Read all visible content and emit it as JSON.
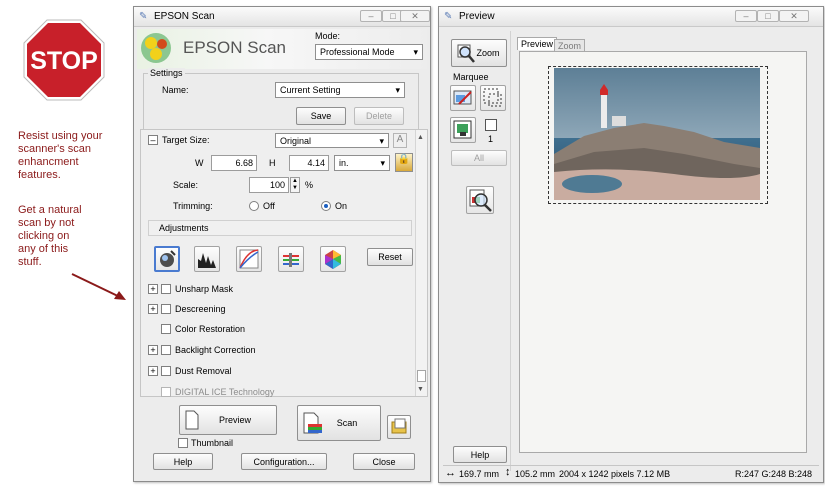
{
  "annotation": {
    "stop_text": "STOP",
    "note1": [
      "Resist using your",
      "scanner's scan",
      "enhancment",
      "features."
    ],
    "note2": [
      "Get a natural",
      "scan by not",
      "clicking on",
      "any of this",
      "stuff."
    ]
  },
  "epson": {
    "title": "EPSON Scan",
    "banner_text": "EPSON Scan",
    "mode_label": "Mode:",
    "mode_value": "Professional Mode",
    "settings_group": "Settings",
    "name_label": "Name:",
    "name_value": "Current Setting",
    "save_label": "Save",
    "delete_label": "Delete",
    "target_size_label": "Target Size:",
    "target_size_value": "Original",
    "w_label": "W",
    "w_value": "6.68",
    "h_label": "H",
    "h_value": "4.14",
    "unit_value": "in.",
    "scale_label": "Scale:",
    "scale_value": "100",
    "scale_unit": "%",
    "trimming_label": "Trimming:",
    "trim_off": "Off",
    "trim_on": "On",
    "adjustments_label": "Adjustments",
    "reset_label": "Reset",
    "options": [
      "Unsharp Mask",
      "Descreening",
      "Color Restoration",
      "Backlight Correction",
      "Dust Removal",
      "DIGITAL ICE Technology"
    ],
    "preview_label": "Preview",
    "scan_label": "Scan",
    "thumbnail_label": "Thumbnail",
    "help_label": "Help",
    "configuration_label": "Configuration...",
    "close_label": "Close",
    "banner_colors": [
      "#2b9b3a",
      "#f2d11a",
      "#d24b1c"
    ]
  },
  "preview": {
    "title": "Preview",
    "zoom_label": "Zoom",
    "marquee_label": "Marquee",
    "marquee_count": "1",
    "all_label": "All",
    "help_label": "Help",
    "tabs": [
      "Preview",
      "Zoom"
    ],
    "width_readout": "169.7 mm",
    "height_readout": "105.2 mm",
    "pixel_info": "2004 x 1242 pixels 7.12 MB",
    "rgb_readout": "R:247 G:248 B:248"
  }
}
